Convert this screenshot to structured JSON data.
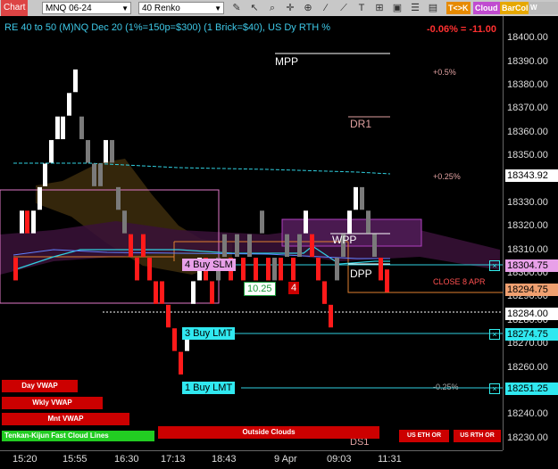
{
  "toolbar": {
    "chart_label": "Chart",
    "instrument": "MNQ 06-24",
    "timeframe": "40 Renko",
    "tags": [
      "T<>K",
      "Cloud",
      "BarCol",
      "W VWAV"
    ],
    "tag_colors": [
      "#e68a00",
      "#c04bd0",
      "#e6a800",
      "#bbbbbb"
    ]
  },
  "header": {
    "title": "RE 40 to 50 (M)NQ Dec 20 (1%=150p=$300) (1 Brick=$40), US Dy RTH %",
    "pnl": "-0.06% = -11.00"
  },
  "annotations": {
    "mpp": "MPP",
    "plus_05": "+0.5%",
    "dr1": "DR1",
    "plus_025": "+0.25%",
    "wpp": "WPP",
    "dpp": "DPP",
    "close_apr": "CLOSE 8 APR",
    "minus_025": "-0.25%",
    "ds1": "DS1",
    "value_box": "10.25",
    "qty_box": "4"
  },
  "orders": {
    "buy_slm": "4 Buy SLM",
    "buy_lmt_3": "3 Buy LMT",
    "buy_lmt_1": "1 Buy LMT"
  },
  "y_axis": {
    "ticks": [
      "18400.00",
      "18390.00",
      "18380.00",
      "18370.00",
      "18360.00",
      "18350.00",
      "18340.00",
      "18330.00",
      "18320.00",
      "18310.00",
      "18300.00",
      "18290.00",
      "18280.00",
      "18270.00",
      "18260.00",
      "18250.00",
      "18240.00",
      "18230.00"
    ],
    "tags": {
      "p1": "18343.92",
      "p2": "18304.75",
      "p3": "18294.75",
      "p4": "18284.00",
      "p5": "18274.75",
      "p6": "18251.25"
    }
  },
  "x_axis": {
    "ticks": [
      "15:20",
      "15:55",
      "16:30",
      "17:13",
      "18:43",
      "9 Apr",
      "09:03",
      "11:31"
    ]
  },
  "buttons": {
    "day_vwap": "Day VWAP",
    "wkly_vwap": "Wkly VWAP",
    "mnt_vwap": "Mnt VWAP",
    "clouds": "Tenkan-Kijun Fast Cloud Lines",
    "outside_clouds": "Outside Clouds",
    "us_eth_or": "US ETH OR",
    "us_rth_or": "US RTH OR"
  },
  "chart_data": {
    "type": "renko",
    "brick_size": 10,
    "bricks": [
      {
        "x": 15,
        "o": 18300,
        "c": 18290,
        "d": "down"
      },
      {
        "x": 22,
        "o": 18310,
        "c": 18320,
        "d": "up"
      },
      {
        "x": 28,
        "o": 18320,
        "c": 18310,
        "d": "down"
      },
      {
        "x": 35,
        "o": 18310,
        "c": 18320,
        "d": "up"
      },
      {
        "x": 42,
        "o": 18320,
        "c": 18330,
        "d": "up"
      },
      {
        "x": 48,
        "o": 18330,
        "c": 18340,
        "d": "up"
      },
      {
        "x": 55,
        "o": 18340,
        "c": 18350,
        "d": "up"
      },
      {
        "x": 62,
        "o": 18350,
        "c": 18360,
        "d": "up"
      },
      {
        "x": 68,
        "o": 18350,
        "c": 18360,
        "d": "up"
      },
      {
        "x": 75,
        "o": 18360,
        "c": 18370,
        "d": "up"
      },
      {
        "x": 82,
        "o": 18370,
        "c": 18380,
        "d": "up"
      },
      {
        "x": 89,
        "o": 18360,
        "c": 18350,
        "d": "gray"
      },
      {
        "x": 96,
        "o": 18350,
        "c": 18340,
        "d": "gray"
      },
      {
        "x": 103,
        "o": 18340,
        "c": 18330,
        "d": "gray"
      },
      {
        "x": 110,
        "o": 18340,
        "c": 18330,
        "d": "gray"
      },
      {
        "x": 116,
        "o": 18340,
        "c": 18350,
        "d": "up"
      },
      {
        "x": 123,
        "o": 18350,
        "c": 18340,
        "d": "gray"
      },
      {
        "x": 130,
        "o": 18330,
        "c": 18320,
        "d": "gray"
      },
      {
        "x": 137,
        "o": 18320,
        "c": 18310,
        "d": "gray"
      },
      {
        "x": 144,
        "o": 18310,
        "c": 18300,
        "d": "down"
      },
      {
        "x": 151,
        "o": 18300,
        "c": 18290,
        "d": "down"
      },
      {
        "x": 158,
        "o": 18310,
        "c": 18300,
        "d": "down"
      },
      {
        "x": 165,
        "o": 18300,
        "c": 18290,
        "d": "down"
      },
      {
        "x": 172,
        "o": 18290,
        "c": 18280,
        "d": "down"
      },
      {
        "x": 179,
        "o": 18290,
        "c": 18280,
        "d": "down"
      },
      {
        "x": 186,
        "o": 18280,
        "c": 18270,
        "d": "down"
      },
      {
        "x": 193,
        "o": 18270,
        "c": 18260,
        "d": "down"
      },
      {
        "x": 200,
        "o": 18260,
        "c": 18250,
        "d": "down"
      },
      {
        "x": 207,
        "o": 18260,
        "c": 18270,
        "d": "up"
      },
      {
        "x": 214,
        "o": 18280,
        "c": 18290,
        "d": "up"
      },
      {
        "x": 221,
        "o": 18290,
        "c": 18300,
        "d": "up"
      },
      {
        "x": 228,
        "o": 18300,
        "c": 18290,
        "d": "down"
      },
      {
        "x": 235,
        "o": 18290,
        "c": 18280,
        "d": "down"
      },
      {
        "x": 242,
        "o": 18290,
        "c": 18300,
        "d": "gray"
      },
      {
        "x": 249,
        "o": 18300,
        "c": 18310,
        "d": "gray"
      },
      {
        "x": 256,
        "o": 18300,
        "c": 18290,
        "d": "down"
      },
      {
        "x": 263,
        "o": 18300,
        "c": 18310,
        "d": "gray"
      },
      {
        "x": 270,
        "o": 18300,
        "c": 18290,
        "d": "down"
      },
      {
        "x": 277,
        "o": 18300,
        "c": 18310,
        "d": "gray"
      },
      {
        "x": 284,
        "o": 18300,
        "c": 18290,
        "d": "down"
      },
      {
        "x": 291,
        "o": 18310,
        "c": 18320,
        "d": "gray"
      },
      {
        "x": 298,
        "o": 18300,
        "c": 18290,
        "d": "down"
      },
      {
        "x": 305,
        "o": 18290,
        "c": 18300,
        "d": "gray"
      },
      {
        "x": 312,
        "o": 18300,
        "c": 18290,
        "d": "down"
      },
      {
        "x": 319,
        "o": 18300,
        "c": 18310,
        "d": "gray"
      },
      {
        "x": 326,
        "o": 18300,
        "c": 18290,
        "d": "down"
      },
      {
        "x": 333,
        "o": 18300,
        "c": 18310,
        "d": "gray"
      },
      {
        "x": 340,
        "o": 18310,
        "c": 18320,
        "d": "up"
      },
      {
        "x": 347,
        "o": 18310,
        "c": 18300,
        "d": "down"
      },
      {
        "x": 354,
        "o": 18300,
        "c": 18290,
        "d": "down"
      },
      {
        "x": 361,
        "o": 18290,
        "c": 18280,
        "d": "down"
      },
      {
        "x": 368,
        "o": 18280,
        "c": 18270,
        "d": "down"
      },
      {
        "x": 375,
        "o": 18290,
        "c": 18300,
        "d": "gray"
      },
      {
        "x": 382,
        "o": 18300,
        "c": 18310,
        "d": "gray"
      },
      {
        "x": 389,
        "o": 18310,
        "c": 18320,
        "d": "up"
      },
      {
        "x": 396,
        "o": 18320,
        "c": 18330,
        "d": "up"
      },
      {
        "x": 403,
        "o": 18330,
        "c": 18320,
        "d": "gray"
      },
      {
        "x": 410,
        "o": 18320,
        "c": 18310,
        "d": "gray"
      },
      {
        "x": 417,
        "o": 18310,
        "c": 18300,
        "d": "gray"
      },
      {
        "x": 424,
        "o": 18300,
        "c": 18290,
        "d": "down"
      },
      {
        "x": 431,
        "o": 18295,
        "c": 18285,
        "d": "down"
      }
    ],
    "ylim": [
      18225,
      18408
    ],
    "colors": {
      "up": "#ffffff",
      "down": "#ff1a1a",
      "gray": "#7a7a7a"
    }
  }
}
